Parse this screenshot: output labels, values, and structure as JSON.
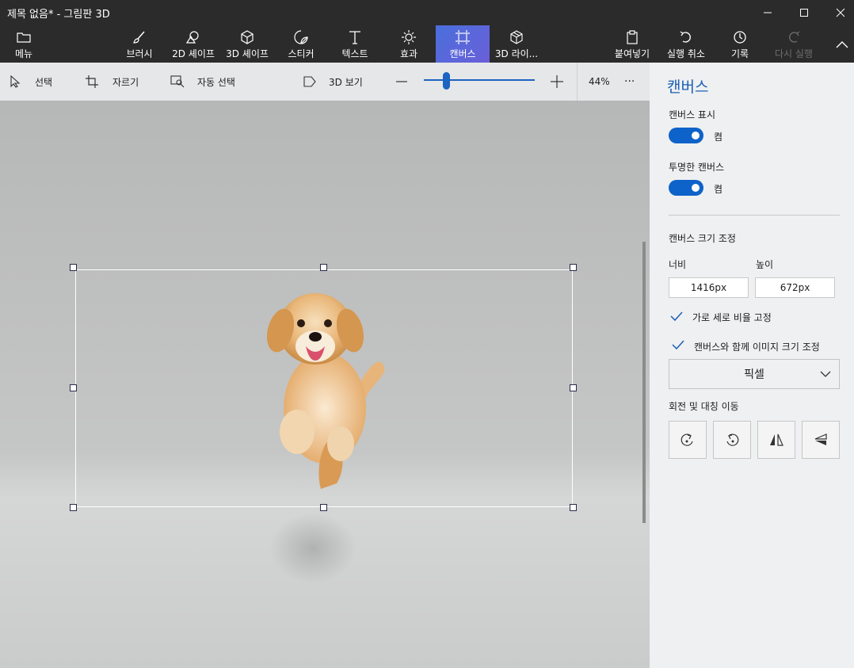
{
  "window": {
    "title": "제목 없음* - 그림판 3D",
    "minimize_icon": "minimize-icon",
    "maximize_icon": "maximize-icon",
    "close_icon": "close-icon"
  },
  "ribbon": {
    "menu": "메뉴",
    "tools": [
      {
        "label": "브러시",
        "icon": "brush-icon"
      },
      {
        "label": "2D 셰이프",
        "icon": "shapes-2d-icon"
      },
      {
        "label": "3D 셰이프",
        "icon": "cube-icon"
      },
      {
        "label": "스티커",
        "icon": "sticker-icon"
      },
      {
        "label": "텍스트",
        "icon": "text-icon"
      },
      {
        "label": "효과",
        "icon": "sun-icon"
      },
      {
        "label": "캔버스",
        "icon": "canvas-icon"
      },
      {
        "label": "3D 라이...",
        "icon": "library-3d-icon"
      }
    ],
    "paste": "붙여넣기",
    "undo": "실행 취소",
    "history": "기록",
    "redo": "다시 실행",
    "active_color": "#5b67da"
  },
  "options": {
    "select": "선택",
    "crop": "자르기",
    "magic_select": "자동 선택",
    "view_3d": "3D 보기",
    "zoom_percent": "44%",
    "zoom_level": 0.44,
    "more": "···"
  },
  "panel": {
    "title": "캔버스",
    "show_canvas_label": "캔버스 표시",
    "show_canvas_state": "켬",
    "transparent_label": "투명한 캔버스",
    "transparent_state": "켬",
    "resize_label": "캔버스 크기 조정",
    "width_label": "너비",
    "height_label": "높이",
    "width_value": "1416px",
    "height_value": "672px",
    "lock_ratio_label": "가로 세로 비율 고정",
    "resize_image_label": "캔버스와 함께 이미지 크기 조정",
    "unit": "픽셀",
    "rotate_label": "회전 및 대칭 이동",
    "accent": "#0d63c9"
  }
}
